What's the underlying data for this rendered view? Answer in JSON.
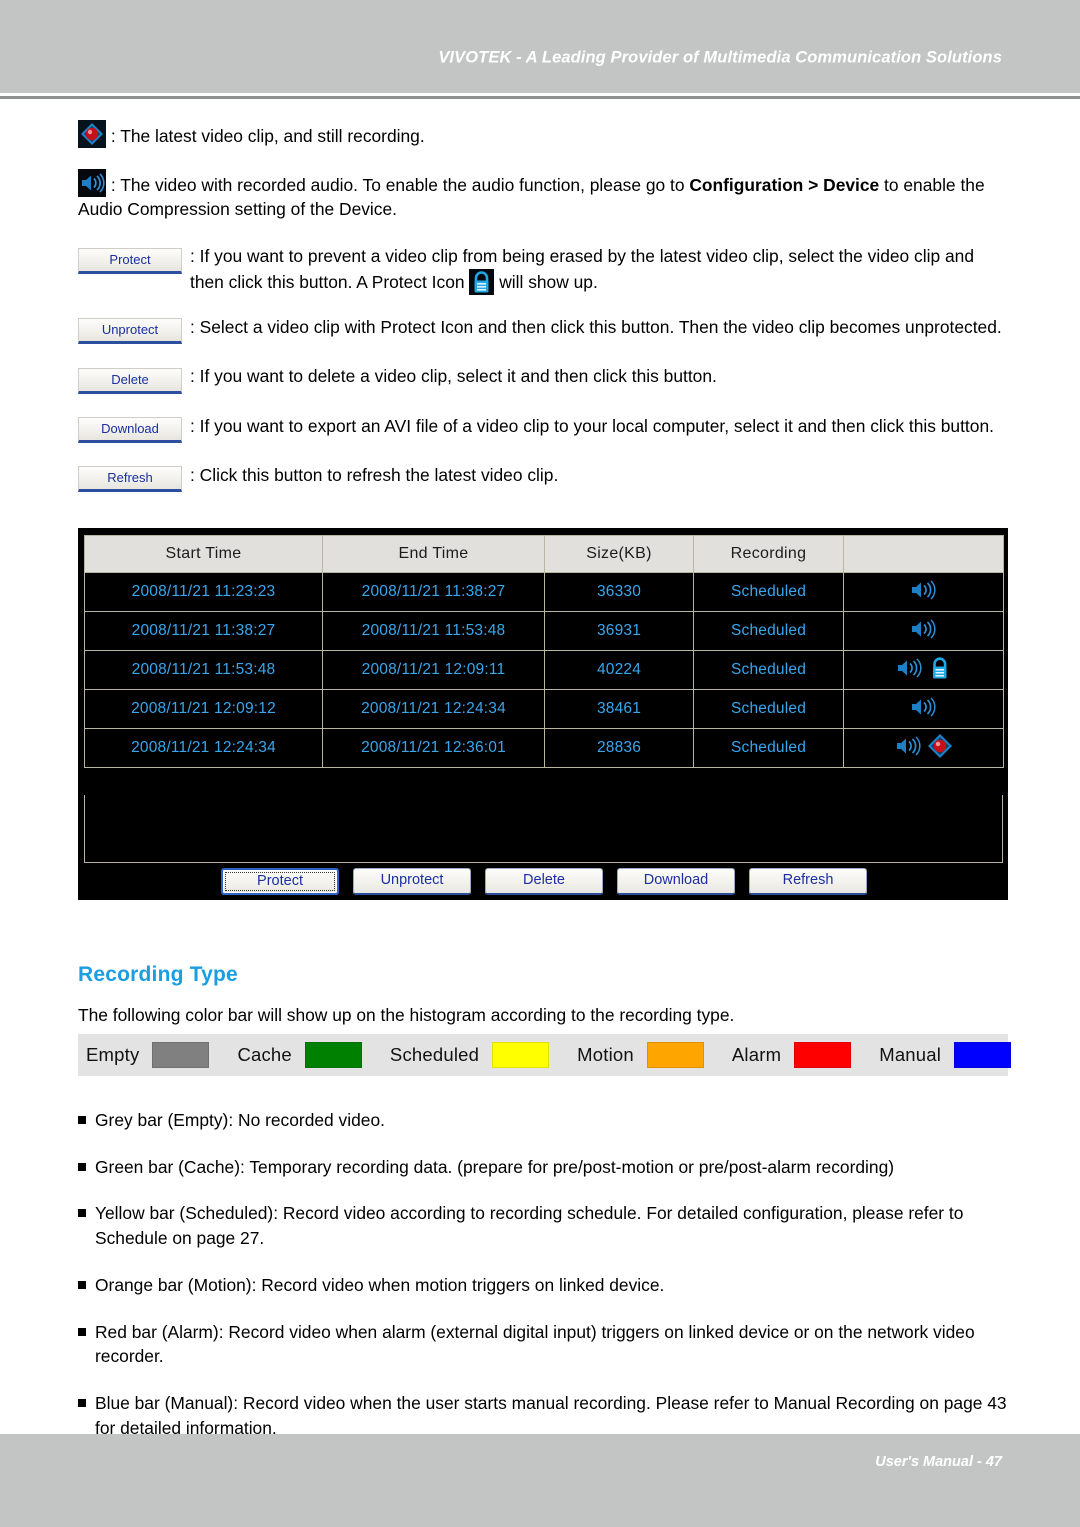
{
  "header": {
    "title": "VIVOTEK - A Leading Provider of Multimedia Communication Solutions"
  },
  "footer": {
    "text": "User's Manual - 47"
  },
  "legend_items": [
    {
      "icon": "recording-orb-icon",
      "text_before": ": The latest video clip, and still recording.",
      "text_bold": "",
      "text_after": ""
    },
    {
      "icon": "audio-speaker-icon",
      "text_before": ": The video with recorded audio. To enable the audio function, please go to ",
      "text_bold": "Configuration > Device",
      "text_after": " to enable the Audio Compression setting of the Device."
    }
  ],
  "button_items": [
    {
      "button_label": "Protect",
      "text_part1": ": If you want to prevent a video clip from being erased by the latest video clip, select the video clip and then click this button. A Protect Icon ",
      "inline_icon": "padlock-icon",
      "text_part2": " will show up."
    },
    {
      "button_label": "Unprotect",
      "text_part1": ": Select a video clip with Protect Icon and then click this button. Then the video clip becomes unprotected.",
      "inline_icon": "",
      "text_part2": ""
    },
    {
      "button_label": "Delete",
      "text_part1": ": If you want to delete a video clip, select it and then click this button.",
      "inline_icon": "",
      "text_part2": ""
    },
    {
      "button_label": "Download",
      "text_part1": ": If you want to export an AVI file of a video clip to your local computer, select it and then click this button.",
      "inline_icon": "",
      "text_part2": ""
    },
    {
      "button_label": "Refresh",
      "text_part1": ": Click this button to refresh the latest video clip.",
      "inline_icon": "",
      "text_part2": ""
    }
  ],
  "recording_list": {
    "columns": [
      "Start Time",
      "End Time",
      "Size(KB)",
      "Recording",
      ""
    ],
    "rows": [
      {
        "start_time": "2008/11/21 11:23:23",
        "end_time": "2008/11/21 11:38:27",
        "size_kb": "36330",
        "recording": "Scheduled",
        "icons": [
          "audio-speaker-icon"
        ]
      },
      {
        "start_time": "2008/11/21 11:38:27",
        "end_time": "2008/11/21 11:53:48",
        "size_kb": "36931",
        "recording": "Scheduled",
        "icons": [
          "audio-speaker-icon"
        ]
      },
      {
        "start_time": "2008/11/21 11:53:48",
        "end_time": "2008/11/21 12:09:11",
        "size_kb": "40224",
        "recording": "Scheduled",
        "icons": [
          "audio-speaker-icon",
          "padlock-icon"
        ]
      },
      {
        "start_time": "2008/11/21 12:09:12",
        "end_time": "2008/11/21 12:24:34",
        "size_kb": "38461",
        "recording": "Scheduled",
        "icons": [
          "audio-speaker-icon"
        ]
      },
      {
        "start_time": "2008/11/21 12:24:34",
        "end_time": "2008/11/21 12:36:01",
        "size_kb": "28836",
        "recording": "Scheduled",
        "icons": [
          "audio-speaker-icon",
          "recording-orb-icon"
        ]
      }
    ],
    "buttons": [
      {
        "label": "Protect",
        "focused": true
      },
      {
        "label": "Unprotect",
        "focused": false
      },
      {
        "label": "Delete",
        "focused": false
      },
      {
        "label": "Download",
        "focused": false
      },
      {
        "label": "Refresh",
        "focused": false
      }
    ]
  },
  "recording_type": {
    "heading": "Recording Type",
    "description": "The following color bar will show up on the histogram according to the recording type.",
    "color_bar": [
      {
        "label": "Empty",
        "color": "#808080"
      },
      {
        "label": "Cache",
        "color": "#008000"
      },
      {
        "label": "Scheduled",
        "color": "#FFFF00"
      },
      {
        "label": "Motion",
        "color": "#FFA500"
      },
      {
        "label": "Alarm",
        "color": "#FF0000"
      },
      {
        "label": "Manual",
        "color": "#0000FF"
      }
    ],
    "bullets": [
      "Grey bar (Empty): No recorded video.",
      "Green bar (Cache): Temporary recording data. (prepare for pre/post-motion or pre/post-alarm recording)",
      "Yellow bar (Scheduled): Record video according to recording schedule. For detailed configuration, please refer to Schedule on page 27.",
      "Orange bar (Motion): Record video when motion triggers on linked device.",
      "Red bar (Alarm): Record video when alarm (external digital input) triggers on linked device or on the network video recorder.",
      "Blue bar (Manual): Record video when the user starts manual recording. Please refer to Manual Recording on page 43 for detailed information."
    ]
  }
}
